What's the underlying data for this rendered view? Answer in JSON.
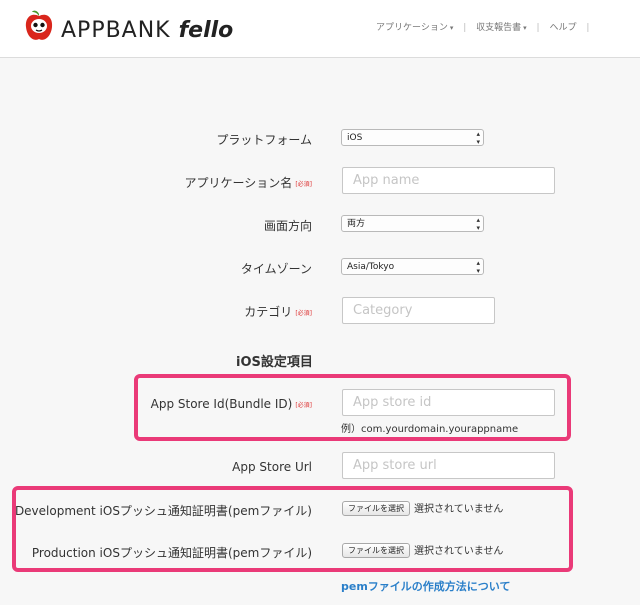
{
  "header": {
    "brand": "APPBANK",
    "brand_sub": "fello",
    "nav": [
      {
        "label": "アプリケーション"
      },
      {
        "label": "収支報告書"
      },
      {
        "label": "ヘルプ"
      }
    ]
  },
  "form": {
    "required_badge": "[必須]",
    "platform": {
      "label": "プラットフォーム",
      "value": "iOS"
    },
    "app_name": {
      "label": "アプリケーション名",
      "placeholder": "App name"
    },
    "orientation": {
      "label": "画面方向",
      "value": "両方"
    },
    "timezone": {
      "label": "タイムゾーン",
      "value": "Asia/Tokyo"
    },
    "category": {
      "label": "カテゴリ",
      "placeholder": "Category"
    },
    "ios_section_title": "iOS設定項目",
    "app_store_id": {
      "label": "App Store Id(Bundle ID)",
      "placeholder": "App store id",
      "example": "例）com.yourdomain.yourappname"
    },
    "app_store_url": {
      "label": "App Store Url",
      "placeholder": "App store url"
    },
    "dev_cert": {
      "label": "Development iOSプッシュ通知証明書(pemファイル)",
      "button": "ファイルを選択",
      "status": "選択されていません"
    },
    "prod_cert": {
      "label": "Production iOSプッシュ通知証明書(pemファイル)",
      "button": "ファイルを選択",
      "status": "選択されていません"
    },
    "pem_help_link": "pemファイルの作成方法について"
  },
  "colors": {
    "highlight": "#ea3a78",
    "link": "#2a7fc9",
    "required": "#dd3333"
  }
}
